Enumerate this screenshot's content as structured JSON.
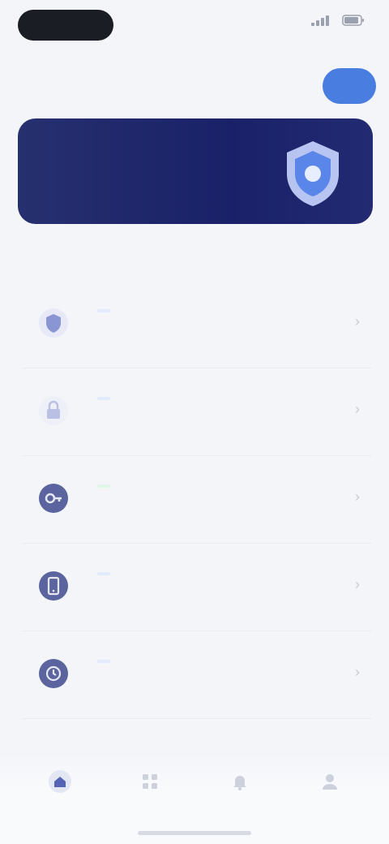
{
  "status_bar": {
    "time": "",
    "battery": ""
  },
  "header": {
    "title": "",
    "action_label": ""
  },
  "banner": {
    "title": "",
    "subtitle": ""
  },
  "section": {
    "title": ""
  },
  "items": [
    {
      "title": "",
      "badge": "",
      "description": "",
      "icon": "shield-icon",
      "icon_color": "#8a95d4",
      "badge_color": "#4a7de0"
    },
    {
      "title": "",
      "badge": "",
      "description": "",
      "icon": "lock-icon",
      "icon_color": "#b9c0e4",
      "badge_color": "#4a7de0"
    },
    {
      "title": "",
      "badge": "",
      "description": "",
      "icon": "key-icon",
      "icon_color": "#5b649e",
      "badge_color": "#4dbf7e"
    },
    {
      "title": "",
      "badge": "",
      "description": "",
      "icon": "device-icon",
      "icon_color": "#5b649e",
      "badge_color": "#4a7de0"
    },
    {
      "title": "",
      "badge": "",
      "description": "",
      "icon": "history-icon",
      "icon_color": "#5b649e",
      "badge_color": "#4a7de0"
    },
    {
      "title": "",
      "badge": "",
      "description": "",
      "icon": "settings-icon",
      "icon_color": "#5b649e",
      "badge_color": "#4a7de0"
    }
  ],
  "tabs": [
    {
      "label": "",
      "icon": "home-icon",
      "active": true
    },
    {
      "label": "",
      "icon": "grid-icon",
      "active": false
    },
    {
      "label": "",
      "icon": "bell-icon",
      "active": false
    },
    {
      "label": "",
      "icon": "profile-icon",
      "active": false
    }
  ],
  "colors": {
    "accent": "#4a7de0",
    "banner_bg": "#1a2168",
    "page_bg": "#f4f5f9"
  }
}
